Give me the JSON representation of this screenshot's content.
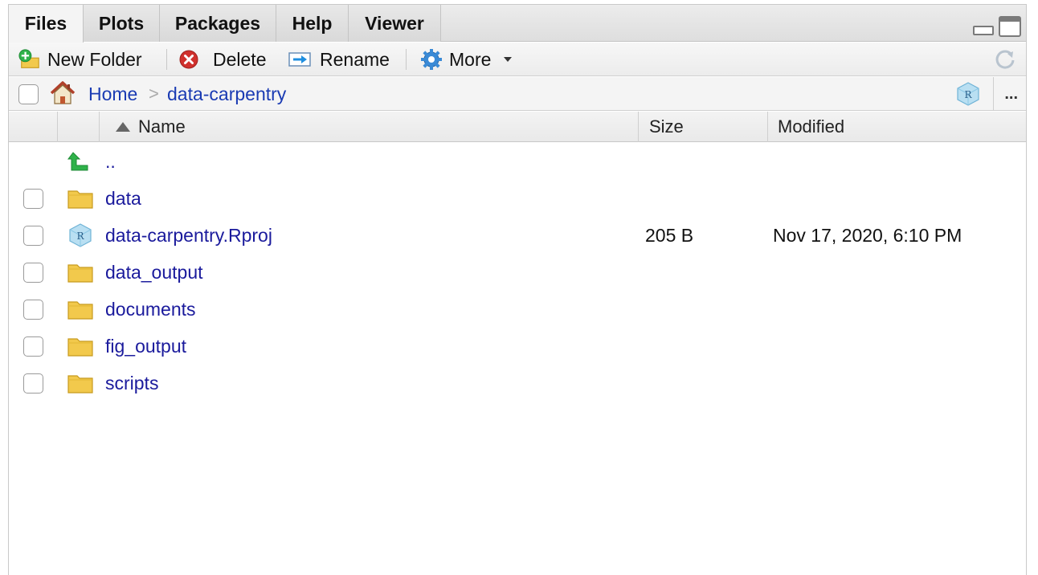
{
  "tabs": [
    {
      "label": "Files",
      "active": true
    },
    {
      "label": "Plots",
      "active": false
    },
    {
      "label": "Packages",
      "active": false
    },
    {
      "label": "Help",
      "active": false
    },
    {
      "label": "Viewer",
      "active": false
    }
  ],
  "toolbar": {
    "new_folder": "New Folder",
    "delete": "Delete",
    "rename": "Rename",
    "more": "More"
  },
  "breadcrumb": {
    "home": "Home",
    "separator": ">",
    "current": "data-carpentry",
    "more": "..."
  },
  "columns": {
    "name": "Name",
    "size": "Size",
    "modified": "Modified"
  },
  "files": [
    {
      "name": "..",
      "type": "parent",
      "size": "",
      "modified": ""
    },
    {
      "name": "data",
      "type": "folder",
      "size": "",
      "modified": ""
    },
    {
      "name": "data-carpentry.Rproj",
      "type": "rproj",
      "size": "205 B",
      "modified": "Nov 17, 2020, 6:10 PM"
    },
    {
      "name": "data_output",
      "type": "folder",
      "size": "",
      "modified": ""
    },
    {
      "name": "documents",
      "type": "folder",
      "size": "",
      "modified": ""
    },
    {
      "name": "fig_output",
      "type": "folder",
      "size": "",
      "modified": ""
    },
    {
      "name": "scripts",
      "type": "folder",
      "size": "",
      "modified": ""
    }
  ],
  "colors": {
    "link": "#1a3bb3",
    "file_link": "#1a1a9c",
    "folder": "#f2c94c",
    "parent_arrow": "#1fa34a"
  }
}
